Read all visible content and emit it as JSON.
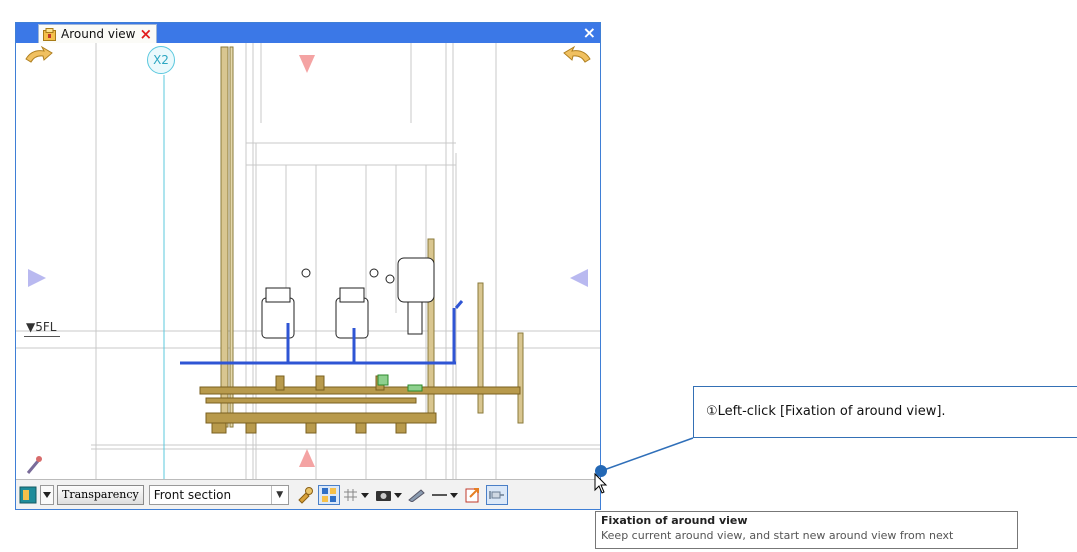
{
  "window": {
    "tab_label": "Around view",
    "tab_close": "×",
    "close_glyph": "×",
    "accent_color": "#3b78e7"
  },
  "canvas": {
    "grid_bubble": "X2",
    "level_label": "▼5FL"
  },
  "toolbar": {
    "transparency_label": "Transparency",
    "section_select": {
      "value": "Front section"
    },
    "icons": [
      "display-mode-icon",
      "dropdown-arrow-icon",
      "wrench-icon",
      "grid-icon",
      "snap-icon",
      "camera-icon",
      "pen-icon",
      "line-style-icon",
      "export-icon",
      "pin-icon"
    ]
  },
  "callout": {
    "text": "①Left-click [Fixation of around view]."
  },
  "tooltip": {
    "title": "Fixation of around view",
    "description": "Keep current around view, and start new around view from next"
  }
}
